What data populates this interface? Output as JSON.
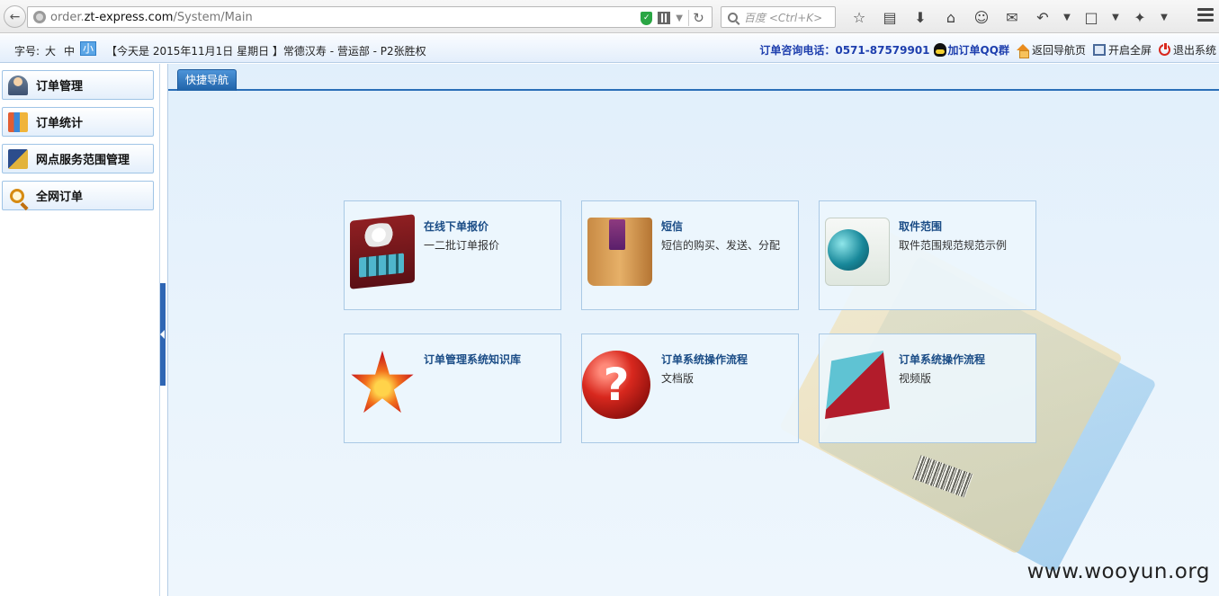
{
  "browser": {
    "url_prefix": "order.",
    "url_domain": "zt-express.com",
    "url_path": "/System/Main",
    "search_placeholder": "百度 <Ctrl+K>"
  },
  "header": {
    "font_size_label": "字号:",
    "font_sizes": [
      "大",
      "中",
      "小"
    ],
    "selected_font_size": "小",
    "today_text": "【今天是 2015年11月1日 星期日 】常德汉寿 - 营运部 - P2张胜权",
    "hotline": "订单咨询电话：0571-87579901",
    "qq_group": "加订单QQ群",
    "back_home": "返回导航页",
    "fullscreen": "开启全屏",
    "logout": "退出系统"
  },
  "sidebar": {
    "items": [
      {
        "label": "订单管理",
        "icon": "user-icon"
      },
      {
        "label": "订单统计",
        "icon": "statistics-icon"
      },
      {
        "label": "网点服务范围管理",
        "icon": "book-icon"
      },
      {
        "label": "全网订单",
        "icon": "magnifier-icon"
      }
    ]
  },
  "main": {
    "tab_label": "快捷导航",
    "cards": [
      {
        "title": "在线下单报价",
        "desc": "一二批订单报价",
        "icon": "calculator-icon"
      },
      {
        "title": "短信",
        "desc": "短信的购买、发送、分配",
        "icon": "box-icon"
      },
      {
        "title": "取件范围",
        "desc": "取件范围规范规范示例",
        "icon": "globe-document-icon"
      },
      {
        "title": "订单管理系统知识库",
        "desc": "",
        "icon": "star-icon"
      },
      {
        "title": "订单系统操作流程",
        "desc": "文档版",
        "icon": "help-icon"
      },
      {
        "title": "订单系统操作流程",
        "desc": "视频版",
        "icon": "film-icon"
      }
    ]
  },
  "watermark": "www.wooyun.org"
}
